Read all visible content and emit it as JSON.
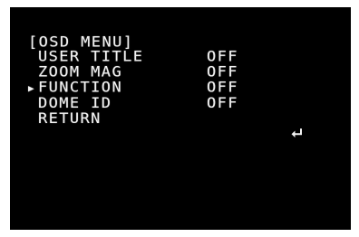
{
  "menu_title": "[OSD MENU]",
  "cursor_glyph": "▶",
  "items": [
    {
      "label": "USER TITLE",
      "value": "OFF",
      "selected": false
    },
    {
      "label": "ZOOM MAG",
      "value": "OFF",
      "selected": false
    },
    {
      "label": "FUNCTION",
      "value": "OFF",
      "selected": true
    },
    {
      "label": "DOME ID",
      "value": "OFF",
      "selected": false
    },
    {
      "label": "RETURN",
      "value": "",
      "selected": false,
      "icon": "return-arrow-icon"
    }
  ],
  "colors": {
    "screen_background": "#000000",
    "text": "#f2f2f2",
    "frame": "#ffffff"
  }
}
